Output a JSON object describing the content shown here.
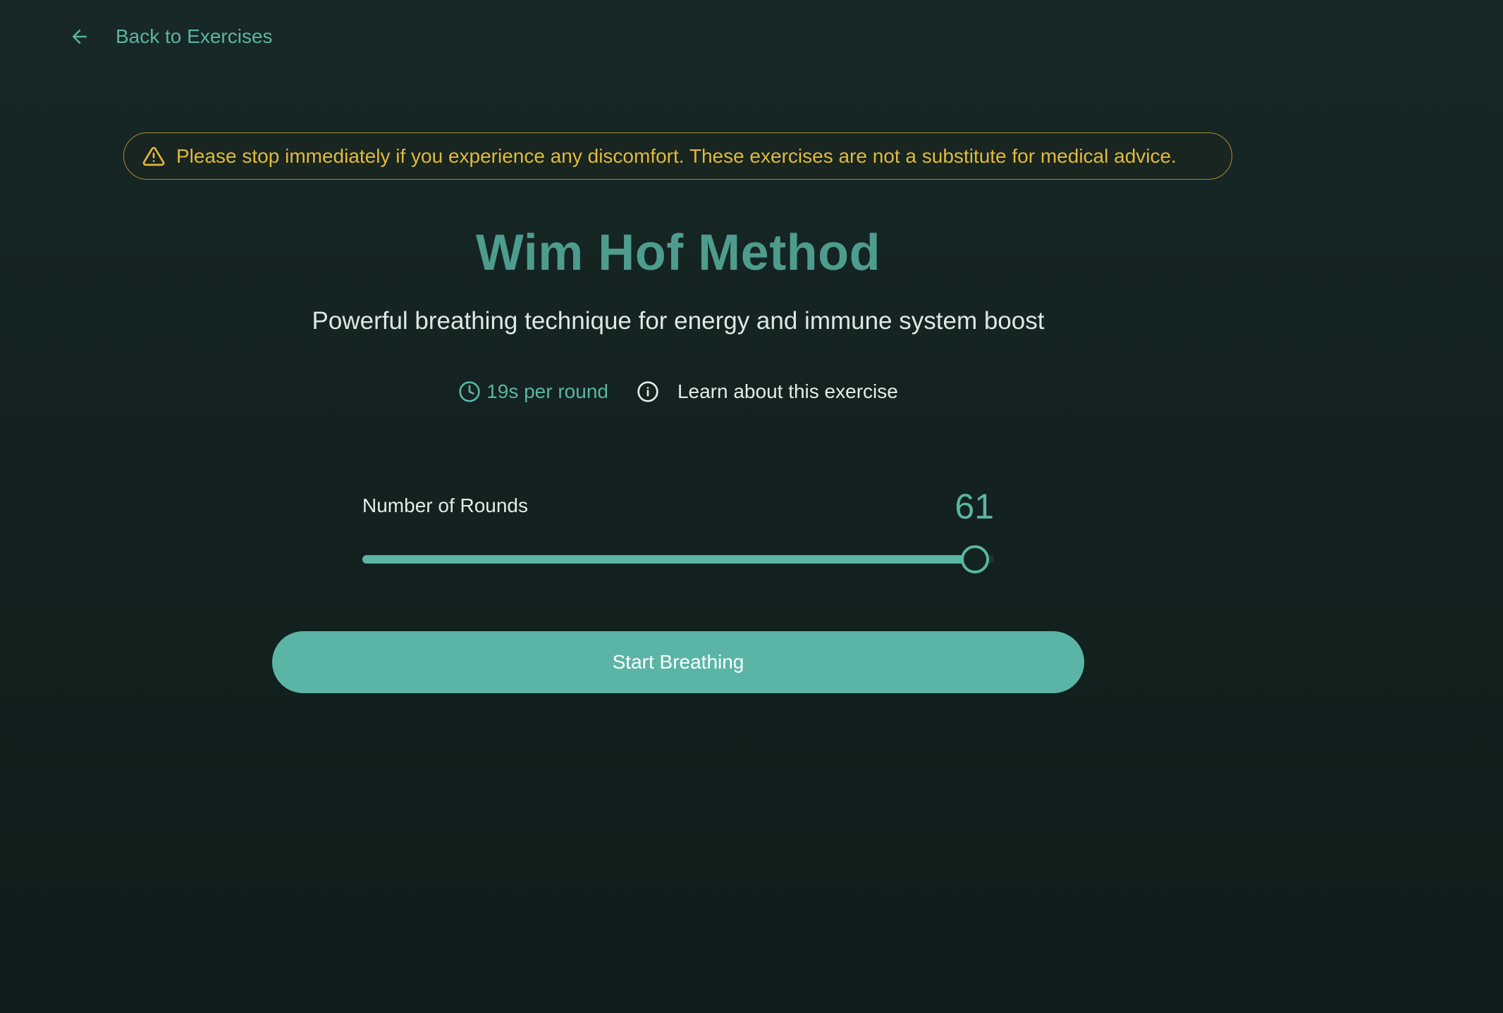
{
  "nav": {
    "back_label": "Back to Exercises",
    "back_icon": "arrow-left-icon"
  },
  "warning": {
    "text": "Please stop immediately if you experience any discomfort. These exercises are not a substitute for medical advice.",
    "icon": "warning-triangle-icon",
    "color": "#e2b93c"
  },
  "exercise": {
    "title": "Wim Hof Method",
    "description": "Powerful breathing technique for energy and immune system boost",
    "duration_text": "19s per round",
    "duration_icon": "clock-icon",
    "learn_label": "Learn about this exercise",
    "learn_icon": "info-icon"
  },
  "rounds": {
    "label": "Number of Rounds",
    "value": "61",
    "slider_fraction": 0.97
  },
  "actions": {
    "start_label": "Start Breathing"
  },
  "colors": {
    "accent": "#5bb5a4",
    "title": "#4e9c8e",
    "background": "#132220",
    "button": "#5bb5a6"
  }
}
